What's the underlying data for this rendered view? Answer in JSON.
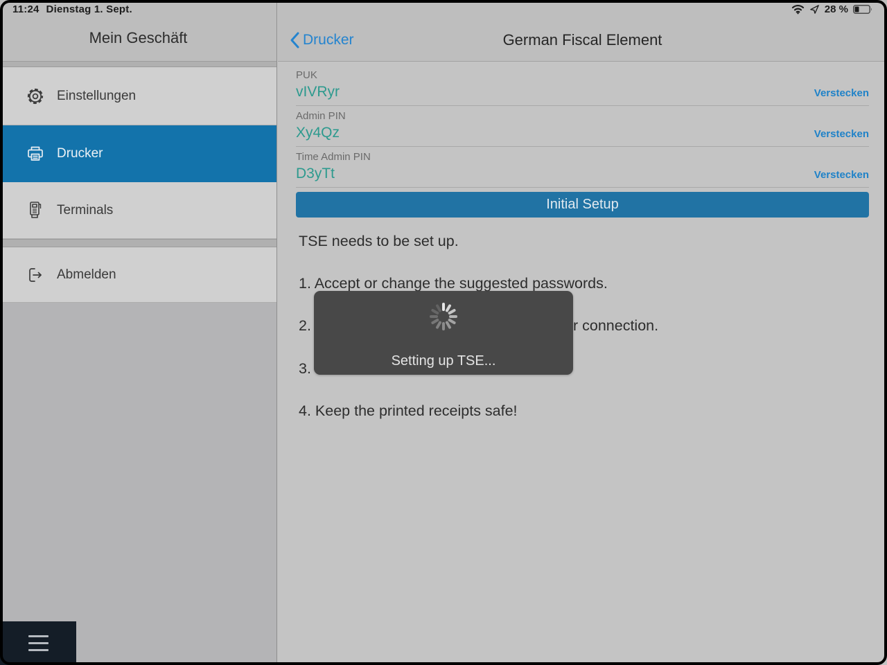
{
  "status_bar": {
    "time": "11:24",
    "date": "Dienstag 1. Sept.",
    "battery_percent": "28 %"
  },
  "sidebar": {
    "title": "Mein Geschäft",
    "items": [
      {
        "label": "Einstellungen",
        "icon": "gear-icon",
        "selected": false
      },
      {
        "label": "Drucker",
        "icon": "printer-icon",
        "selected": true
      },
      {
        "label": "Terminals",
        "icon": "terminal-icon",
        "selected": false
      },
      {
        "label": "Abmelden",
        "icon": "logout-icon",
        "selected": false
      }
    ]
  },
  "header": {
    "back_label": "Drucker",
    "title": "German Fiscal Element"
  },
  "fields": [
    {
      "label": "PUK",
      "value": "vIVRyr",
      "action": "Verstecken"
    },
    {
      "label": "Admin PIN",
      "value": "Xy4Qz",
      "action": "Verstecken"
    },
    {
      "label": "Time Admin PIN",
      "value": "D3yTt",
      "action": "Verstecken"
    }
  ],
  "setup_button_label": "Initial Setup",
  "instructions": {
    "intro": "TSE needs to be set up.",
    "step1": "1. Accept or change the suggested passwords.",
    "step2_prefix": "2.",
    "step2_suffix": "r connection.",
    "step3_prefix": "3.",
    "step4": "4. Keep the printed receipts safe!"
  },
  "overlay": {
    "message": "Setting up TSE..."
  },
  "colors": {
    "accent_blue": "#2484cf",
    "button_blue": "#2173a4",
    "selected_row_blue": "#1373ab",
    "value_green": "#2d9a8e",
    "hud_gray": "#484848"
  }
}
